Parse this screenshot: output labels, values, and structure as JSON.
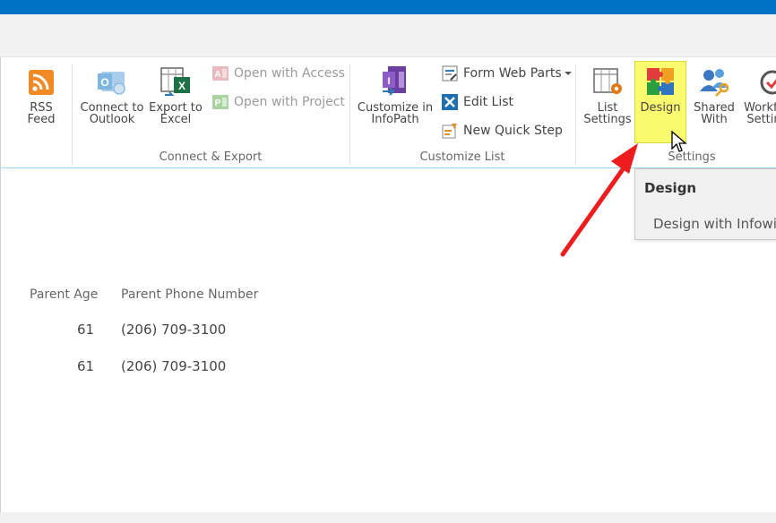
{
  "ribbon": {
    "rss": {
      "label": "RSS\nFeed"
    },
    "connect_export": {
      "group_label": "Connect & Export",
      "connect_outlook": "Connect to\nOutlook",
      "export_excel": "Export to\nExcel",
      "open_access": "Open with Access",
      "open_project": "Open with Project"
    },
    "customize_list": {
      "group_label": "Customize List",
      "customize_infopath": "Customize in\nInfoPath",
      "form_web_parts": "Form Web Parts",
      "edit_list": "Edit List",
      "new_quick_step": "New Quick Step"
    },
    "settings": {
      "group_label": "Settings",
      "list_settings": "List\nSettings",
      "design": "Design",
      "shared_with": "Shared\nWith",
      "workflow_settings": "Workflow\nSettings"
    }
  },
  "tooltip": {
    "title": "Design",
    "body": "Design with Infowise"
  },
  "table": {
    "headers": [
      "Parent Age",
      "Parent Phone Number"
    ],
    "rows": [
      [
        "61",
        "(206) 709-3100"
      ],
      [
        "61",
        "(206) 709-3100"
      ]
    ]
  },
  "colors": {
    "topbar": "#0072c6",
    "design_highlight": "#fafa6e",
    "arrow": "#ee1c1c"
  }
}
